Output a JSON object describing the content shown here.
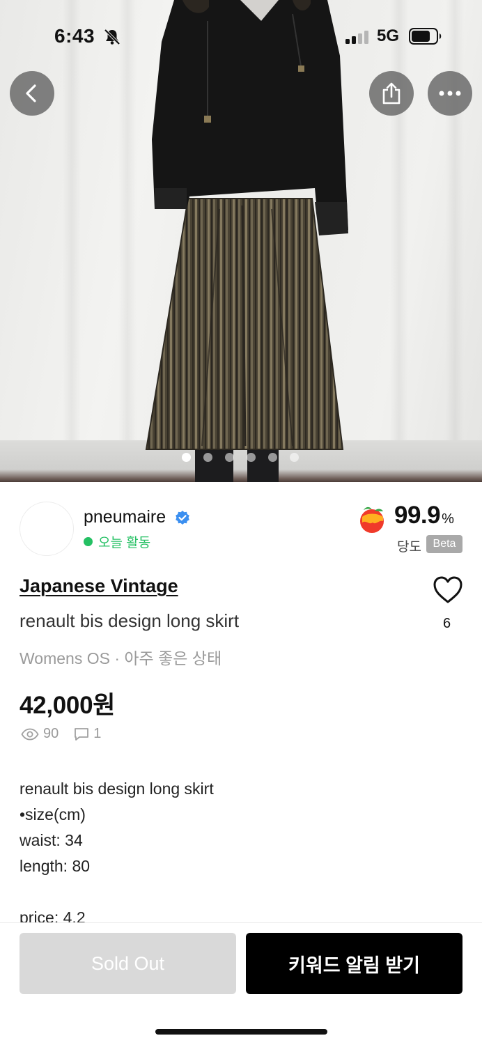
{
  "status_bar": {
    "time": "6:43",
    "network": "5G"
  },
  "hero": {
    "image_count": 6,
    "active_index": 0
  },
  "seller": {
    "name": "pneumaire",
    "verified": true,
    "activity": "오늘 활동",
    "score_value": "99.9",
    "score_unit": "%",
    "score_label": "당도",
    "score_badge": "Beta"
  },
  "product": {
    "brand": "Japanese Vintage",
    "title": "renault bis design long skirt",
    "meta": "Womens OS · 아주 좋은 상태",
    "likes": "6",
    "price": "42,000원",
    "views": "90",
    "comments": "1",
    "description": [
      "renault bis design long skirt",
      "•size(cm)",
      "waist: 34",
      "length: 80",
      "",
      "price: 4.2"
    ]
  },
  "actions": {
    "sold_out_label": "Sold Out",
    "keyword_alert_label": "키워드 알림 받기"
  },
  "colors": {
    "active_green": "#24c063",
    "verified_blue": "#3b8ff0",
    "primary_button": "#000000",
    "disabled_button": "#d9d9d9"
  },
  "icons": {
    "back": "chevron-left-icon",
    "share": "share-icon",
    "more": "more-horizontal-icon",
    "bell_muted": "bell-slash-icon",
    "verified": "verified-badge-icon",
    "peach": "peach-icon",
    "heart": "heart-outline-icon",
    "views": "eye-icon",
    "comments": "comment-icon"
  }
}
